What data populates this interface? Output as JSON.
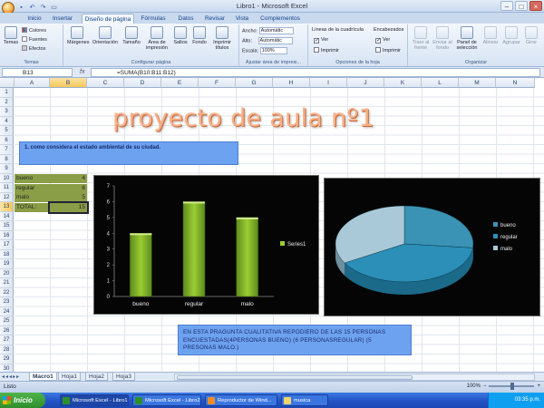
{
  "window": {
    "title": "Libro1 - Microsoft Excel"
  },
  "tabs": [
    "Inicio",
    "Insertar",
    "Diseño de página",
    "Fórmulas",
    "Datos",
    "Revisar",
    "Vista",
    "Complementos"
  ],
  "ribbon": {
    "temas": {
      "label": "Temas",
      "temas_btn": "Temas",
      "colores": "Colores",
      "fuentes": "Fuentes",
      "efectos": "Efectos"
    },
    "configurar": {
      "label": "Configurar página",
      "margenes": "Márgenes",
      "orientacion": "Orientación",
      "tamano": "Tamaño",
      "area": "Área de impresión",
      "saltos": "Saltos",
      "fondo": "Fondo",
      "imprimir": "Imprimir títulos"
    },
    "ajustar": {
      "label": "Ajustar área de impresi...",
      "ancho_label": "Ancho:",
      "ancho_value": "Automátic",
      "alto_label": "Alto:",
      "alto_value": "Automátic",
      "escala_label": "Escala:",
      "escala_value": "100%"
    },
    "opciones": {
      "label": "Opciones de la hoja",
      "lineas": "Líneas de la cuadrícula",
      "encabezados": "Encabezados",
      "ver": "Ver",
      "imprimir": "Imprimir"
    },
    "organizar": {
      "label": "Organizar",
      "traer": "Traer al frente",
      "enviar": "Enviar al fondo",
      "panel": "Panel de selección",
      "alinear": "Alinear",
      "agrupar": "Agrupar",
      "girar": "Girar"
    }
  },
  "formula_bar": {
    "name_box": "B13",
    "fx": "fx",
    "formula": "=SUMA(B10:B11:B12)"
  },
  "columns": [
    "A",
    "B",
    "C",
    "D",
    "E",
    "F",
    "G",
    "H",
    "I",
    "J",
    "K",
    "L",
    "M",
    "N"
  ],
  "rows": [
    "1",
    "2",
    "3",
    "4",
    "5",
    "6",
    "7",
    "8",
    "9",
    "10",
    "11",
    "12",
    "13",
    "14",
    "15",
    "16",
    "17",
    "18",
    "19",
    "20",
    "21",
    "22",
    "23",
    "24",
    "25",
    "26",
    "27",
    "28",
    "29",
    "30"
  ],
  "sheet": {
    "title": "proyecto de aula nº1",
    "question": "1. como considera el estado ambiental de su ciudad.",
    "table": [
      {
        "label": "bueno",
        "value": "4"
      },
      {
        "label": "regular",
        "value": "6"
      },
      {
        "label": "malo",
        "value": "5"
      },
      {
        "label": "TOTAL:",
        "value": "15"
      }
    ],
    "note": "EN ESTA PRAGUNTA CUALITATIVA REPODIERO DE LAS 15 PERSONAS ENCUESTADAS(4PERSONAS BUENO) (6 PERSONASREGULAR) (5 PRESONAS MALO.)"
  },
  "chart_data": [
    {
      "type": "bar",
      "categories": [
        "bueno",
        "regular",
        "malo"
      ],
      "series": [
        {
          "name": "Series1",
          "values": [
            4,
            6,
            5
          ]
        }
      ],
      "ylim": [
        0,
        7
      ],
      "yticks": [
        "0",
        "1",
        "2",
        "3",
        "4",
        "5",
        "6",
        "7"
      ],
      "legend": "right",
      "grid": false,
      "colors": {
        "bar": "#9acd32",
        "background": "#050505"
      }
    },
    {
      "type": "pie",
      "categories": [
        "bueno",
        "regular",
        "malo"
      ],
      "values": [
        4,
        6,
        5
      ],
      "legend": "right",
      "colors": {
        "bueno": "#3a93b4",
        "regular": "#2b8fb8",
        "malo": "#a9c9d8",
        "background": "#050505"
      }
    }
  ],
  "sheet_tabs": [
    "Macro1",
    "Hoja1",
    "Hoja2",
    "Hoja3"
  ],
  "status": {
    "text": "Listo",
    "zoom": "100%"
  },
  "taskbar": {
    "start": "Inicio",
    "tasks": [
      "Microsoft Excel - Libro1",
      "Microsoft Excel - Libro2",
      "Reproductor de Wind...",
      "musica"
    ],
    "clock": "03:35 p.m."
  }
}
